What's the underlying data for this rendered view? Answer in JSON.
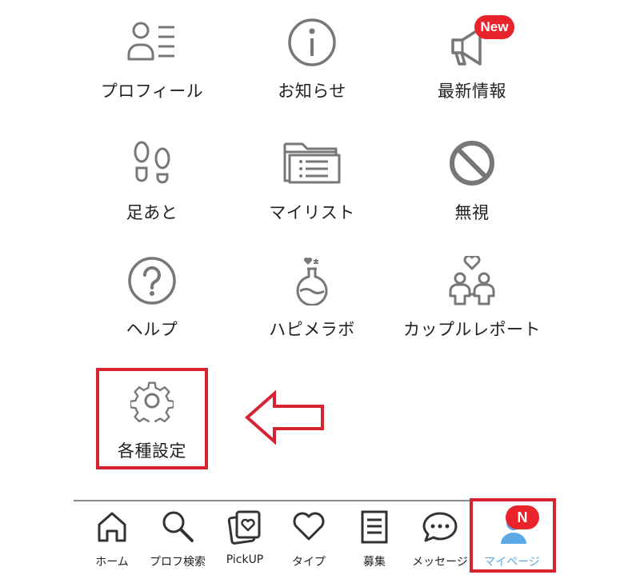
{
  "menu": {
    "profile": "プロフィール",
    "news": "お知らせ",
    "latest": "最新情報",
    "latest_badge": "New",
    "footprints": "足あと",
    "mylist": "マイリスト",
    "ignore": "無視",
    "help": "ヘルプ",
    "lab": "ハピメラボ",
    "couple_report": "カップルレポート",
    "settings": "各種設定"
  },
  "icons": {
    "profile": "profile-list-icon",
    "news": "info-icon",
    "latest": "megaphone-icon",
    "footprints": "footprints-icon",
    "mylist": "folder-list-icon",
    "ignore": "block-icon",
    "help": "question-icon",
    "lab": "flask-heart-icon",
    "couple_report": "couple-heart-icon",
    "settings": "gear-icon",
    "pointer": "left-arrow-icon"
  },
  "tabbar": {
    "home": "ホーム",
    "profile_search": "プロフ検索",
    "pickup": "PickUP",
    "type": "タイプ",
    "recruit": "募集",
    "message": "メッセージ",
    "mypage": "マイページ",
    "mypage_badge": "N"
  },
  "colors": {
    "highlight": "#d7232f",
    "badge": "#e8232b",
    "active_tab": "#5aa9e6",
    "icon_gray": "#777777"
  }
}
